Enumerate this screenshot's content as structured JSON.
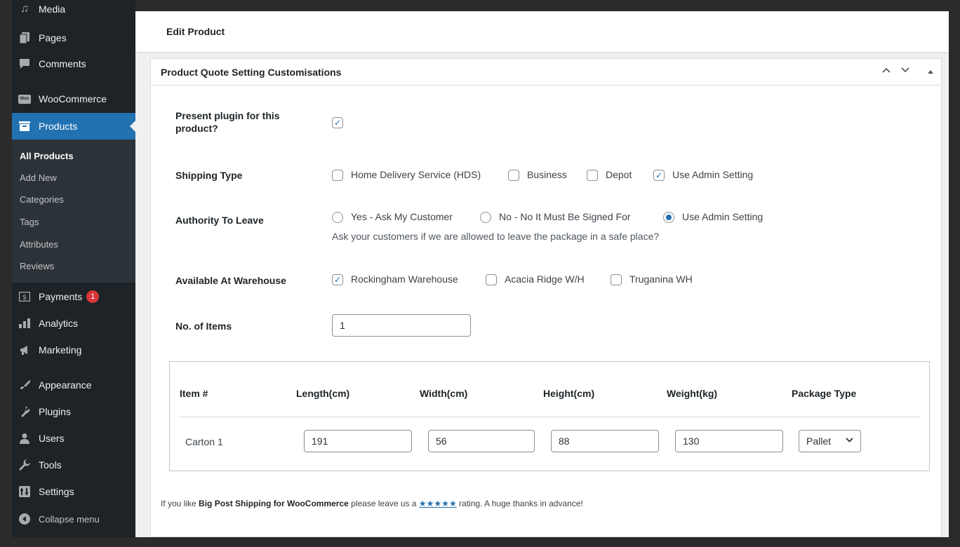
{
  "sidebar": {
    "media": "Media",
    "pages": "Pages",
    "comments": "Comments",
    "woocommerce": "WooCommerce",
    "products": "Products",
    "sub": [
      "All Products",
      "Add New",
      "Categories",
      "Tags",
      "Attributes",
      "Reviews"
    ],
    "payments": "Payments",
    "payments_badge": "1",
    "analytics": "Analytics",
    "marketing": "Marketing",
    "appearance": "Appearance",
    "plugins": "Plugins",
    "users": "Users",
    "tools": "Tools",
    "settings": "Settings",
    "collapse": "Collapse menu",
    "woo_icon_text": "Woo"
  },
  "header": {
    "title": "Edit Product"
  },
  "postbox": {
    "title": "Product Quote Setting Customisations",
    "present_label": "Present plugin for this product?",
    "present_checked": true,
    "shipping_label": "Shipping Type",
    "shipping_options": [
      "Home Delivery Service (HDS)",
      "Business",
      "Depot",
      "Use Admin Setting"
    ],
    "shipping_checked": [
      false,
      false,
      false,
      true
    ],
    "atl_label": "Authority To Leave",
    "atl_options": [
      "Yes - Ask My Customer",
      "No - No It Must Be Signed For",
      "Use Admin Setting"
    ],
    "atl_selected": 2,
    "atl_desc": "Ask your customers if we are allowed to leave the package in a safe place?",
    "warehouse_label": "Available At Warehouse",
    "warehouse_options": [
      "Rockingham Warehouse",
      "Acacia Ridge W/H",
      "Truganina WH"
    ],
    "warehouse_checked": [
      true,
      false,
      false
    ],
    "items_label": "No. of Items",
    "items_value": "1"
  },
  "items_table": {
    "headers": [
      "Item #",
      "Length(cm)",
      "Width(cm)",
      "Height(cm)",
      "Weight(kg)",
      "Package Type"
    ],
    "rows": [
      {
        "item": "Carton 1",
        "length": "191",
        "width": "56",
        "height": "88",
        "weight": "130",
        "package": "Pallet"
      }
    ]
  },
  "footer": {
    "prefix": "If you like ",
    "plugin": "Big Post Shipping for WooCommerce",
    "middle": " please leave us a ",
    "stars": "★★★★★",
    "suffix": " rating. A huge thanks in advance!"
  },
  "colors": {
    "accent": "#2271b1",
    "sidebar": "#1d2327",
    "badge": "#d63638"
  }
}
